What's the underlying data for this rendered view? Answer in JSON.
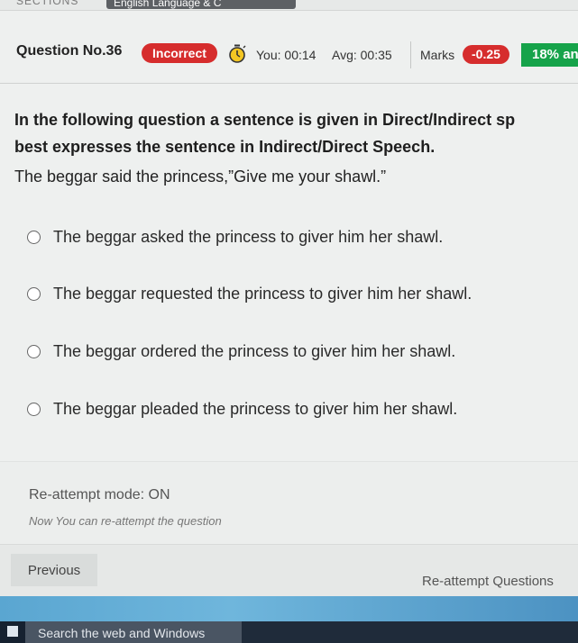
{
  "topbar": {
    "sections_label": "SECTIONS",
    "subject_tab": "English Language & C"
  },
  "question_header": {
    "question_number": "Question No.36",
    "status": "Incorrect",
    "timer_icon": "stopwatch-icon",
    "your_time": "You: 00:14",
    "avg_time": "Avg: 00:35",
    "marks_label": "Marks",
    "marks_value": "-0.25",
    "percent_badge": "18% an"
  },
  "question": {
    "instruction_line1": "In the following question a sentence is given in Direct/Indirect sp",
    "instruction_line2": "best expresses the sentence in Indirect/Direct Speech.",
    "sentence": "The beggar said the princess,”Give me your shawl.”",
    "options": [
      "The beggar asked the princess to giver him her shawl.",
      "The beggar requested the princess to giver him her shawl.",
      "The beggar ordered the princess to giver him her shawl.",
      "The beggar pleaded the princess to giver him her shawl."
    ]
  },
  "reattempt": {
    "mode": "Re-attempt mode: ON",
    "note": "Now You can re-attempt the question"
  },
  "footer": {
    "previous_label": "Previous",
    "reattempt_label": "Re-attempt Questions"
  },
  "taskbar": {
    "search_placeholder": "Search the web and Windows"
  },
  "colors": {
    "incorrect_red": "#d62d2d",
    "percent_green": "#16a34a",
    "taskbar": "#1f2b3a"
  }
}
